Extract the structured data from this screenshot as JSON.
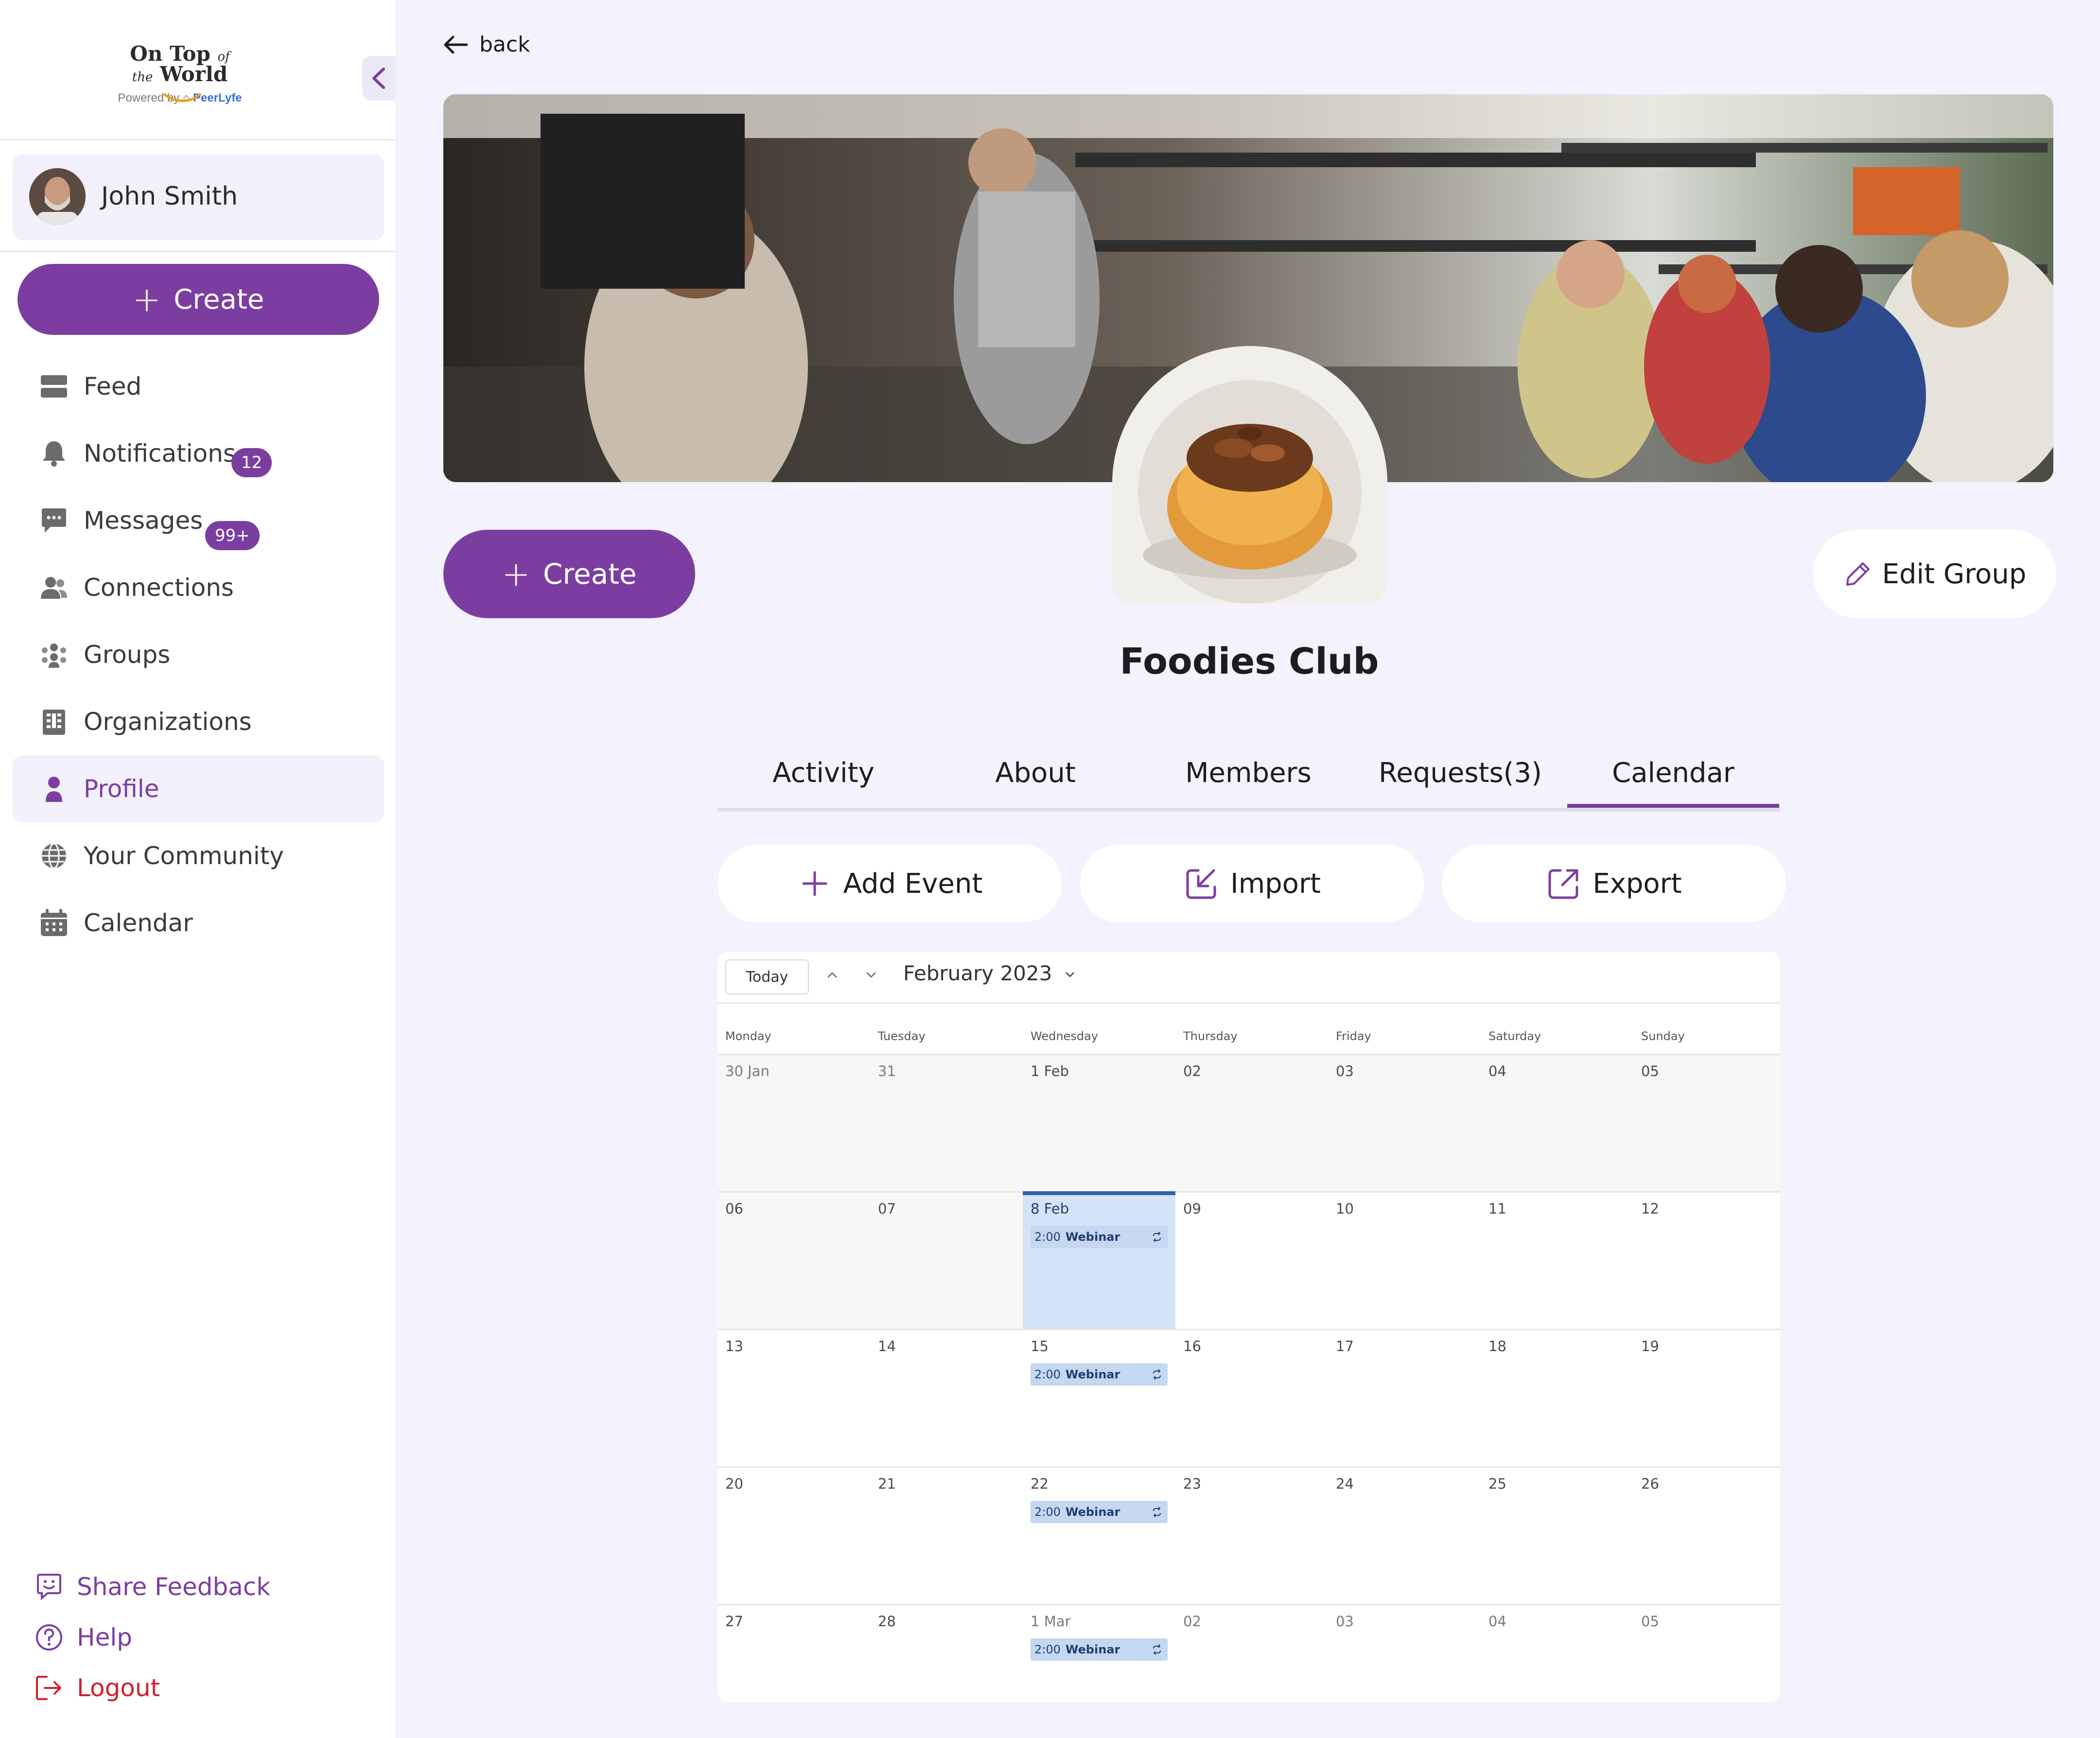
{
  "brand": {
    "logo_line1": "On Top",
    "logo_of": "of",
    "logo_the": "the",
    "logo_line2": "World",
    "powered_by": "Powered by",
    "powered_brand": "PeerLyfe",
    "accent": "#7b3ea0"
  },
  "user": {
    "name": "John Smith"
  },
  "sidebar": {
    "create_label": "Create",
    "items": [
      {
        "label": "Feed",
        "icon": "feed-icon"
      },
      {
        "label": "Notifications",
        "icon": "bell-icon",
        "badge": "12"
      },
      {
        "label": "Messages",
        "icon": "chat-icon",
        "badge": "99+"
      },
      {
        "label": "Connections",
        "icon": "people-icon"
      },
      {
        "label": "Groups",
        "icon": "groups-icon"
      },
      {
        "label": "Organizations",
        "icon": "building-icon"
      },
      {
        "label": "Profile",
        "icon": "person-icon",
        "active": true
      },
      {
        "label": "Your Community",
        "icon": "globe-icon"
      },
      {
        "label": "Calendar",
        "icon": "calendar-icon"
      }
    ],
    "footer": {
      "feedback": "Share Feedback",
      "help": "Help",
      "logout": "Logout"
    }
  },
  "main": {
    "back_label": "back",
    "create_label": "Create",
    "edit_group_label": "Edit Group",
    "group_name": "Foodies Club",
    "tabs": [
      {
        "label": "Activity"
      },
      {
        "label": "About"
      },
      {
        "label": "Members"
      },
      {
        "label": "Requests(3)"
      },
      {
        "label": "Calendar",
        "active": true
      }
    ],
    "actions": {
      "add_event": "Add Event",
      "import": "Import",
      "export": "Export"
    }
  },
  "calendar": {
    "today_label": "Today",
    "month_label": "February 2023",
    "weekdays": [
      "Monday",
      "Tuesday",
      "Wednesday",
      "Thursday",
      "Friday",
      "Saturday",
      "Sunday"
    ],
    "weeks": [
      [
        "30 Jan",
        "31",
        "1 Feb",
        "02",
        "03",
        "04",
        "05"
      ],
      [
        "06",
        "07",
        "8 Feb",
        "09",
        "10",
        "11",
        "12"
      ],
      [
        "13",
        "14",
        "15",
        "16",
        "17",
        "18",
        "19"
      ],
      [
        "20",
        "21",
        "22",
        "23",
        "24",
        "25",
        "26"
      ],
      [
        "27",
        "28",
        "1 Mar",
        "02",
        "03",
        "04",
        "05"
      ]
    ],
    "event_time": "2:00",
    "event_title": "Webinar",
    "today_color": "#d4e3f7",
    "event_color": "#c5d7f1"
  }
}
